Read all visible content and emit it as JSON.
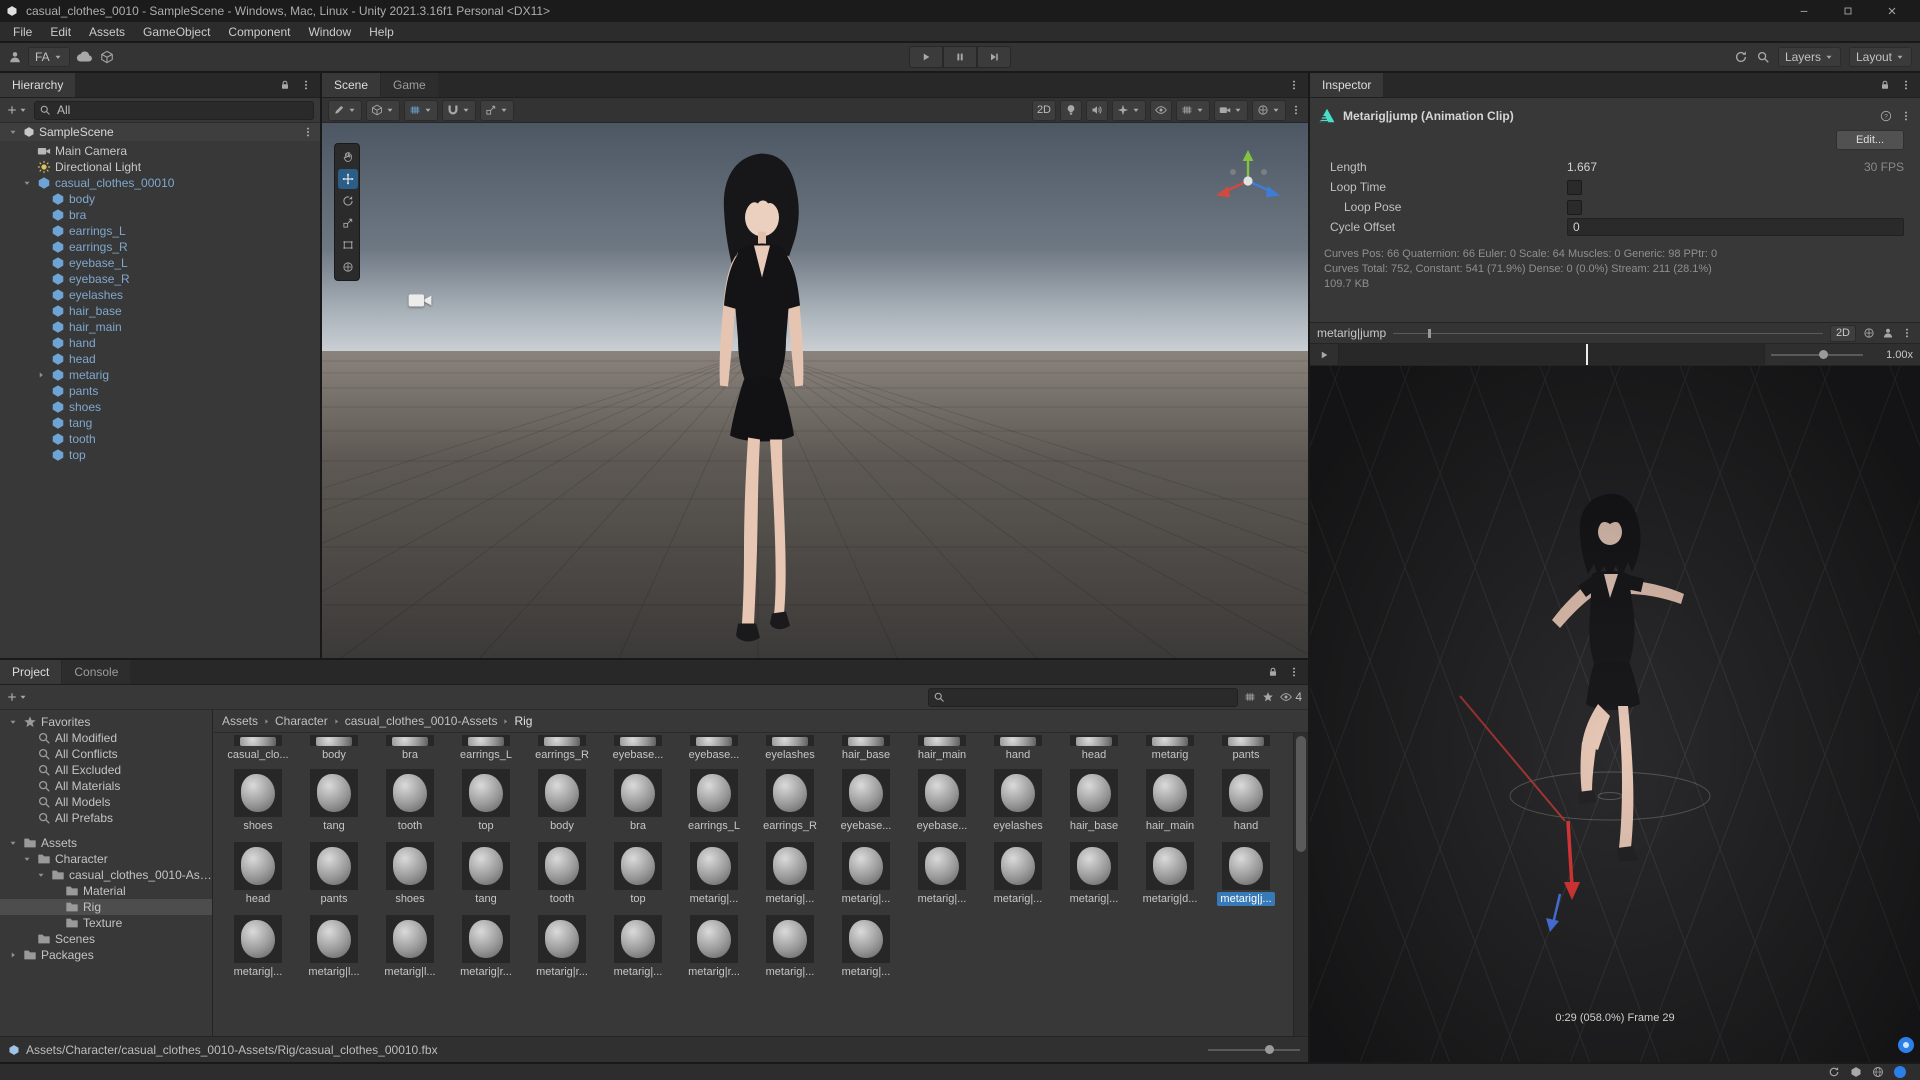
{
  "window": {
    "title": "casual_clothes_0010 - SampleScene - Windows, Mac, Linux - Unity 2021.3.16f1 Personal <DX11>"
  },
  "menu": {
    "items": [
      "File",
      "Edit",
      "Assets",
      "GameObject",
      "Component",
      "Window",
      "Help"
    ]
  },
  "toolbar": {
    "account": "FA",
    "layers": "Layers",
    "layout": "Layout"
  },
  "hierarchy": {
    "tab": "Hierarchy",
    "search_text": "All",
    "scene_name": "SampleScene",
    "items": [
      {
        "label": "Main Camera",
        "icon": "camera",
        "depth": 1
      },
      {
        "label": "Directional Light",
        "icon": "light",
        "depth": 1
      },
      {
        "label": "casual_clothes_00010",
        "icon": "cube",
        "depth": 1,
        "prefab": true,
        "arrow": "down"
      },
      {
        "label": "body",
        "icon": "cube",
        "depth": 2,
        "prefab": true
      },
      {
        "label": "bra",
        "icon": "cube",
        "depth": 2,
        "prefab": true
      },
      {
        "label": "earrings_L",
        "icon": "cube",
        "depth": 2,
        "prefab": true
      },
      {
        "label": "earrings_R",
        "icon": "cube",
        "depth": 2,
        "prefab": true
      },
      {
        "label": "eyebase_L",
        "icon": "cube",
        "depth": 2,
        "prefab": true
      },
      {
        "label": "eyebase_R",
        "icon": "cube",
        "depth": 2,
        "prefab": true
      },
      {
        "label": "eyelashes",
        "icon": "cube",
        "depth": 2,
        "prefab": true
      },
      {
        "label": "hair_base",
        "icon": "cube",
        "depth": 2,
        "prefab": true
      },
      {
        "label": "hair_main",
        "icon": "cube",
        "depth": 2,
        "prefab": true
      },
      {
        "label": "hand",
        "icon": "cube",
        "depth": 2,
        "prefab": true
      },
      {
        "label": "head",
        "icon": "cube",
        "depth": 2,
        "prefab": true
      },
      {
        "label": "metarig",
        "icon": "cube",
        "depth": 2,
        "prefab": true,
        "arrow": "right"
      },
      {
        "label": "pants",
        "icon": "cube",
        "depth": 2,
        "prefab": true
      },
      {
        "label": "shoes",
        "icon": "cube",
        "depth": 2,
        "prefab": true
      },
      {
        "label": "tang",
        "icon": "cube",
        "depth": 2,
        "prefab": true
      },
      {
        "label": "tooth",
        "icon": "cube",
        "depth": 2,
        "prefab": true
      },
      {
        "label": "top",
        "icon": "cube",
        "depth": 2,
        "prefab": true
      }
    ]
  },
  "scene_view": {
    "tab_scene": "Scene",
    "tab_game": "Game",
    "two_d": "2D"
  },
  "inspector": {
    "tab": "Inspector",
    "clip_title": "Metarig|jump (Animation Clip)",
    "edit_button": "Edit...",
    "length_label": "Length",
    "length_value": "1.667",
    "fps": "30 FPS",
    "loop_time_label": "Loop Time",
    "loop_pose_label": "Loop Pose",
    "cycle_offset_label": "Cycle Offset",
    "cycle_offset_value": "0",
    "curves": [
      "Curves Pos: 66 Quaternion: 66 Euler: 0 Scale: 64 Muscles: 0 Generic: 98 PPtr: 0",
      "Curves Total: 752, Constant: 541 (71.9%) Dense: 0 (0.0%) Stream: 211 (28.1%)",
      "109.7 KB"
    ],
    "preview": {
      "clip_name": "metarig|jump",
      "two_d": "2D",
      "speed": "1.00x",
      "frame_info": "0:29 (058.0%) Frame 29"
    }
  },
  "project": {
    "tab_project": "Project",
    "tab_console": "Console",
    "search_value": "",
    "eye_count": "4",
    "favorites_label": "Favorites",
    "favorites": [
      "All Modified",
      "All Conflicts",
      "All Excluded",
      "All Materials",
      "All Models",
      "All Prefabs"
    ],
    "folders": [
      {
        "label": "Assets",
        "depth": 0,
        "arrow": "down"
      },
      {
        "label": "Character",
        "depth": 1,
        "arrow": "down"
      },
      {
        "label": "casual_clothes_0010-Assets",
        "depth": 2,
        "arrow": "down"
      },
      {
        "label": "Material",
        "depth": 3
      },
      {
        "label": "Rig",
        "depth": 3,
        "selected": true
      },
      {
        "label": "Texture",
        "depth": 3
      },
      {
        "label": "Scenes",
        "depth": 1
      },
      {
        "label": "Packages",
        "depth": 0,
        "arrow": "right"
      }
    ],
    "breadcrumb": [
      "Assets",
      "Character",
      "casual_clothes_0010-Assets",
      "Rig"
    ],
    "grid": {
      "row1": [
        {
          "label": "casual_clo...",
          "type": "model"
        },
        {
          "label": "body",
          "type": "mesh"
        },
        {
          "label": "bra",
          "type": "mesh"
        },
        {
          "label": "earrings_L",
          "type": "mesh"
        },
        {
          "label": "earrings_R",
          "type": "mesh"
        },
        {
          "label": "eyebase...",
          "type": "mesh"
        },
        {
          "label": "eyebase...",
          "type": "mesh"
        },
        {
          "label": "eyelashes",
          "type": "mesh"
        },
        {
          "label": "hair_base",
          "type": "mesh"
        },
        {
          "label": "hair_main",
          "type": "mesh"
        },
        {
          "label": "hand",
          "type": "mesh"
        },
        {
          "label": "head",
          "type": "mesh"
        },
        {
          "label": "metarig",
          "type": "mesh"
        },
        {
          "label": "pants",
          "type": "mesh"
        }
      ],
      "row2": [
        {
          "label": "shoes",
          "type": "mesh"
        },
        {
          "label": "tang",
          "type": "mesh"
        },
        {
          "label": "tooth",
          "type": "mesh"
        },
        {
          "label": "top",
          "type": "mesh"
        },
        {
          "label": "body",
          "type": "mesh"
        },
        {
          "label": "bra",
          "type": "mesh"
        },
        {
          "label": "earrings_L",
          "type": "mesh"
        },
        {
          "label": "earrings_R",
          "type": "mesh"
        },
        {
          "label": "eyebase...",
          "type": "mesh"
        },
        {
          "label": "eyebase...",
          "type": "mesh"
        },
        {
          "label": "eyelashes",
          "type": "mesh"
        },
        {
          "label": "hair_base",
          "type": "mesh"
        },
        {
          "label": "hair_main",
          "type": "mesh"
        },
        {
          "label": "hand",
          "type": "mesh"
        }
      ],
      "row3": [
        {
          "label": "head",
          "type": "mesh"
        },
        {
          "label": "pants",
          "type": "mesh"
        },
        {
          "label": "shoes",
          "type": "mesh"
        },
        {
          "label": "tang",
          "type": "mesh"
        },
        {
          "label": "tooth",
          "type": "mesh"
        },
        {
          "label": "top",
          "type": "mesh"
        },
        {
          "label": "metarig|...",
          "type": "clip"
        },
        {
          "label": "metarig|...",
          "type": "clip"
        },
        {
          "label": "metarig|...",
          "type": "clip"
        },
        {
          "label": "metarig|...",
          "type": "clip"
        },
        {
          "label": "metarig|...",
          "type": "clip"
        },
        {
          "label": "metarig|...",
          "type": "clip"
        },
        {
          "label": "metarig|d...",
          "type": "clip"
        },
        {
          "label": "metarig|j...",
          "type": "clip",
          "selected": true
        }
      ],
      "row4": [
        {
          "label": "metarig|...",
          "type": "clip"
        },
        {
          "label": "metarig|l...",
          "type": "clip"
        },
        {
          "label": "metarig|l...",
          "type": "clip"
        },
        {
          "label": "metarig|r...",
          "type": "clip"
        },
        {
          "label": "metarig|r...",
          "type": "clip"
        },
        {
          "label": "metarig|...",
          "type": "clip"
        },
        {
          "label": "metarig|r...",
          "type": "clip"
        },
        {
          "label": "metarig|...",
          "type": "clip"
        },
        {
          "label": "metarig|...",
          "type": "clip"
        }
      ]
    },
    "path": "Assets/Character/casual_clothes_0010-Assets/Rig/casual_clothes_00010.fbx"
  },
  "icons": {
    "search": "magnifier",
    "lock": "padlock",
    "menu": "vertical-dots",
    "play": "triangle",
    "pause": "double-bar",
    "step": "triangle-bar",
    "caret": "down-triangle",
    "folder": "folder",
    "star": "star",
    "eye": "eye",
    "clip": "cyan-triangle-with-motion-lines",
    "camera": "video-camera",
    "light": "sun",
    "cube": "3d-cube"
  },
  "colors": {
    "accent": "#3879B8",
    "prefab_text": "#7FA8CE",
    "clip_icon": "#4ADEC9",
    "selection_gray": "#4D4D4D"
  }
}
